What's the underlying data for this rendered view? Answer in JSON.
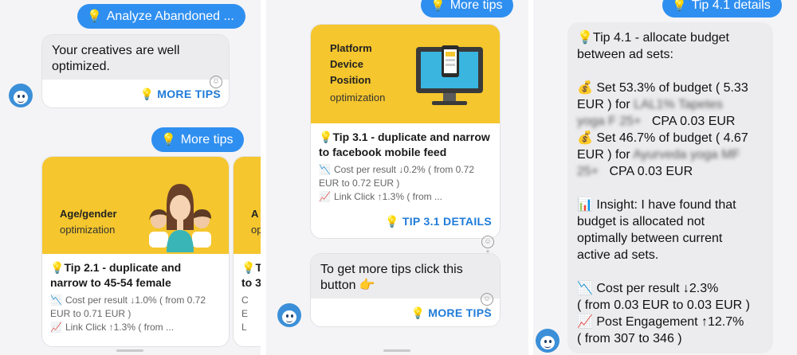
{
  "panel1": {
    "user_btn_top": "Analyze Abandoned ...",
    "bot_message": "Your creatives are well optimized.",
    "more_tips_link": "MORE TIPS",
    "user_btn_more": "More tips",
    "card": {
      "banner_title": "Age/gender",
      "banner_sub": "optimization",
      "tip_title": "Tip 2.1 - duplicate and narrow to 45-54 female",
      "stat1": "Cost per result ↓1.0% ( from 0.72 EUR to 0.71 EUR )",
      "stat2": "Link Click ↑1.3% ( from ..."
    },
    "card2": {
      "banner_title": "A",
      "banner_sub": "op",
      "tip_title": "T",
      "tip_title2": "to 3",
      "stat1": "C",
      "stat2": "E",
      "stat3": "L"
    }
  },
  "panel2": {
    "user_btn_more": "More tips",
    "card": {
      "banner_line1": "Platform",
      "banner_line2": "Device",
      "banner_line3": "Position",
      "banner_sub": "optimization",
      "tip_title": "Tip 3.1 - duplicate and narrow to facebook mobile feed",
      "stat1": "Cost per result ↓0.2% ( from 0.72 EUR to 0.72 EUR )",
      "stat2": "Link Click ↑1.3% ( from ...",
      "details_link": "TIP 3.1 DETAILS"
    },
    "bot_message": "To get more tips click this button 👉",
    "more_tips_link": "MORE TIPS"
  },
  "panel3": {
    "user_btn_details": "Tip 4.1 details",
    "l1": "💡Tip 4.1 - allocate budget",
    "l2": "between ad sets:",
    "l3": "💰 Set 53.3% of budget ( 5.33",
    "l4": "EUR ) for",
    "l4_blur": "LAL1% Tapetes",
    "l5_blur": "yoga F 25+",
    "l5": "CPA 0.03 EUR",
    "l6": "💰 Set 46.7% of budget ( 4.67",
    "l7": "EUR ) for",
    "l7_blur": "Ayurveda yoga MF",
    "l8_blur": "25+",
    "l8": "CPA 0.03 EUR",
    "l9": "📊 Insight: I have found that",
    "l10": "budget is allocated not",
    "l11": "optimally between current",
    "l12": "active ad sets.",
    "l13": "📉 Cost per result ↓2.3%",
    "l14": "( from 0.03 EUR to 0.03 EUR )",
    "l15": "📈 Post Engagement ↑12.7%",
    "l16": "( from 307 to 346 )"
  },
  "icons": {
    "bulb": "💡",
    "react": "☺+"
  },
  "colors": {
    "accent": "#2f8ff0",
    "link": "#1f7bd8",
    "banner": "#f5c62d"
  }
}
